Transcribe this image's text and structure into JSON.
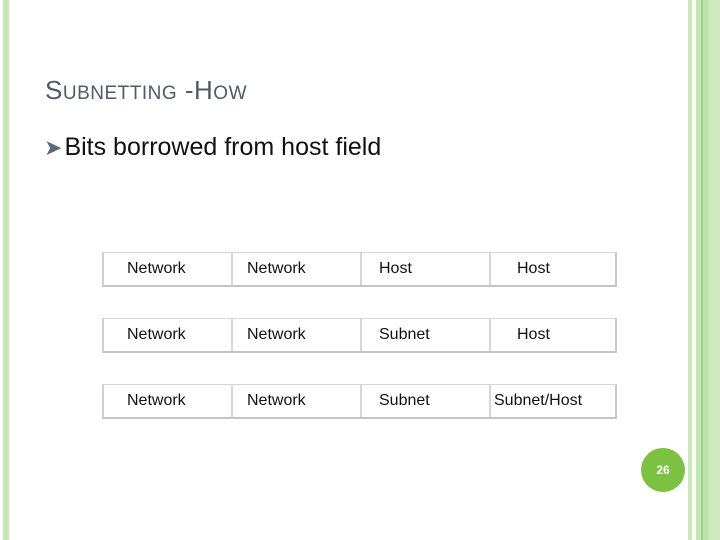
{
  "slide": {
    "title_first_letter": "S",
    "title_rest_1": "UBNETTING",
    "title_sep": " -",
    "title_h": "H",
    "title_rest_2": "OW",
    "title_full": "Subnetting - How",
    "bullet_icon": "arrow-bullet-icon",
    "bullet_text": "Bits borrowed from host field",
    "page_number": "26"
  },
  "rows": [
    {
      "cells": [
        "Network",
        "Network",
        "Host",
        "Host"
      ]
    },
    {
      "cells": [
        "Network",
        "Network",
        "Subnet",
        "Host"
      ]
    },
    {
      "cells": [
        "Network",
        "Network",
        "Subnet",
        "Subnet/Host"
      ]
    }
  ],
  "colors": {
    "accent_green": "#7dc142",
    "stripe_green": "#c5e6b5",
    "title_gray": "#4f5b66"
  }
}
